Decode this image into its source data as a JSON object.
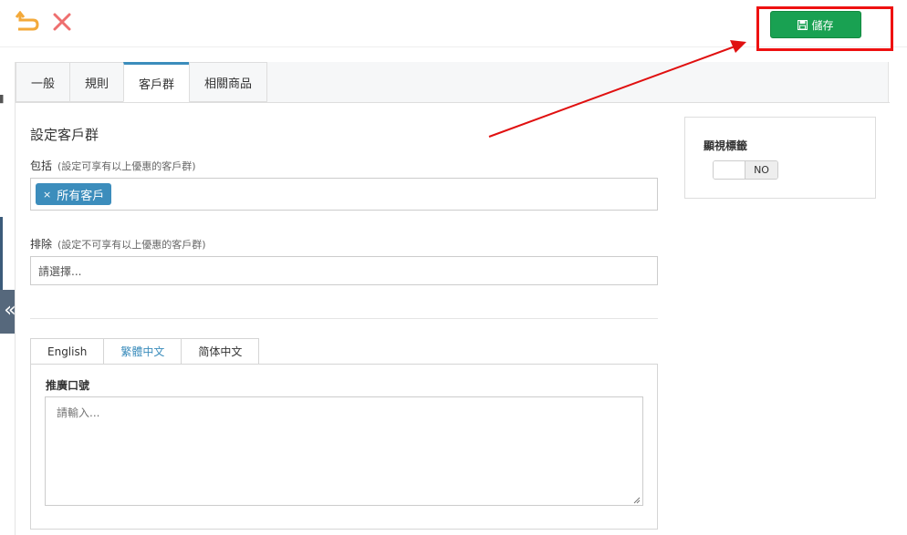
{
  "toolbar": {
    "back_icon": "undo-arrow-icon",
    "close_icon": "close-icon",
    "save_label": "儲存",
    "save_icon": "floppy-disk-icon",
    "accent": "#19a152",
    "highlight_color": "#ee1111"
  },
  "tabs": [
    {
      "label": "一般",
      "active": false
    },
    {
      "label": "規則",
      "active": false
    },
    {
      "label": "客戶群",
      "active": true
    },
    {
      "label": "相關商品",
      "active": false
    }
  ],
  "customer_group": {
    "section_title": "設定客戶群",
    "include_label": "包括",
    "include_hint": "(設定可享有以上優惠的客戶群)",
    "include_tags": [
      {
        "label": "所有客戶",
        "remove": "×"
      }
    ],
    "exclude_label": "排除",
    "exclude_hint": "(設定不可享有以上優惠的客戶群)",
    "exclude_placeholder": "請選擇..."
  },
  "languages": {
    "tabs": [
      {
        "label": "English",
        "active": false
      },
      {
        "label": "繁體中文",
        "active": true
      },
      {
        "label": "简体中文",
        "active": false
      }
    ],
    "slogan_label": "推廣口號",
    "slogan_placeholder": "請輸入..."
  },
  "side": {
    "label": "顯視標籤",
    "toggle_text": "NO",
    "toggle_on": false
  },
  "collapse_glyph": "«",
  "colors": {
    "active_tab": "#3c8dbc",
    "tag_bg": "#3c8dbc"
  }
}
